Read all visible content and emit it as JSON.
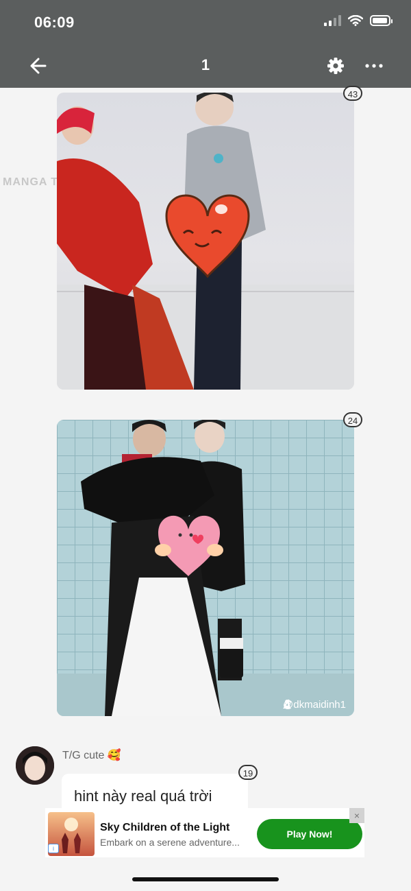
{
  "status_bar": {
    "time": "06:09"
  },
  "toolbar": {
    "title": "1"
  },
  "icons": {
    "back": "arrow-left-icon",
    "settings": "gear-icon",
    "more": "more-horizontal-icon"
  },
  "posts": [
    {
      "badge": "43",
      "watermark": "MANGA T"
    },
    {
      "badge": "24",
      "credit": "@dkmaidinh1"
    }
  ],
  "comment": {
    "author": "T/G cute 🥰",
    "text": "hint này real quá trời",
    "badge": "19"
  },
  "ad": {
    "title": "Sky Children of the Light",
    "description": "Embark on a serene adventure...",
    "cta": "Play Now!",
    "close": "×",
    "info": "i"
  },
  "colors": {
    "header_bg": "#5b5e5e",
    "cta_green": "#18931d",
    "page_bg": "#f4f4f4"
  }
}
